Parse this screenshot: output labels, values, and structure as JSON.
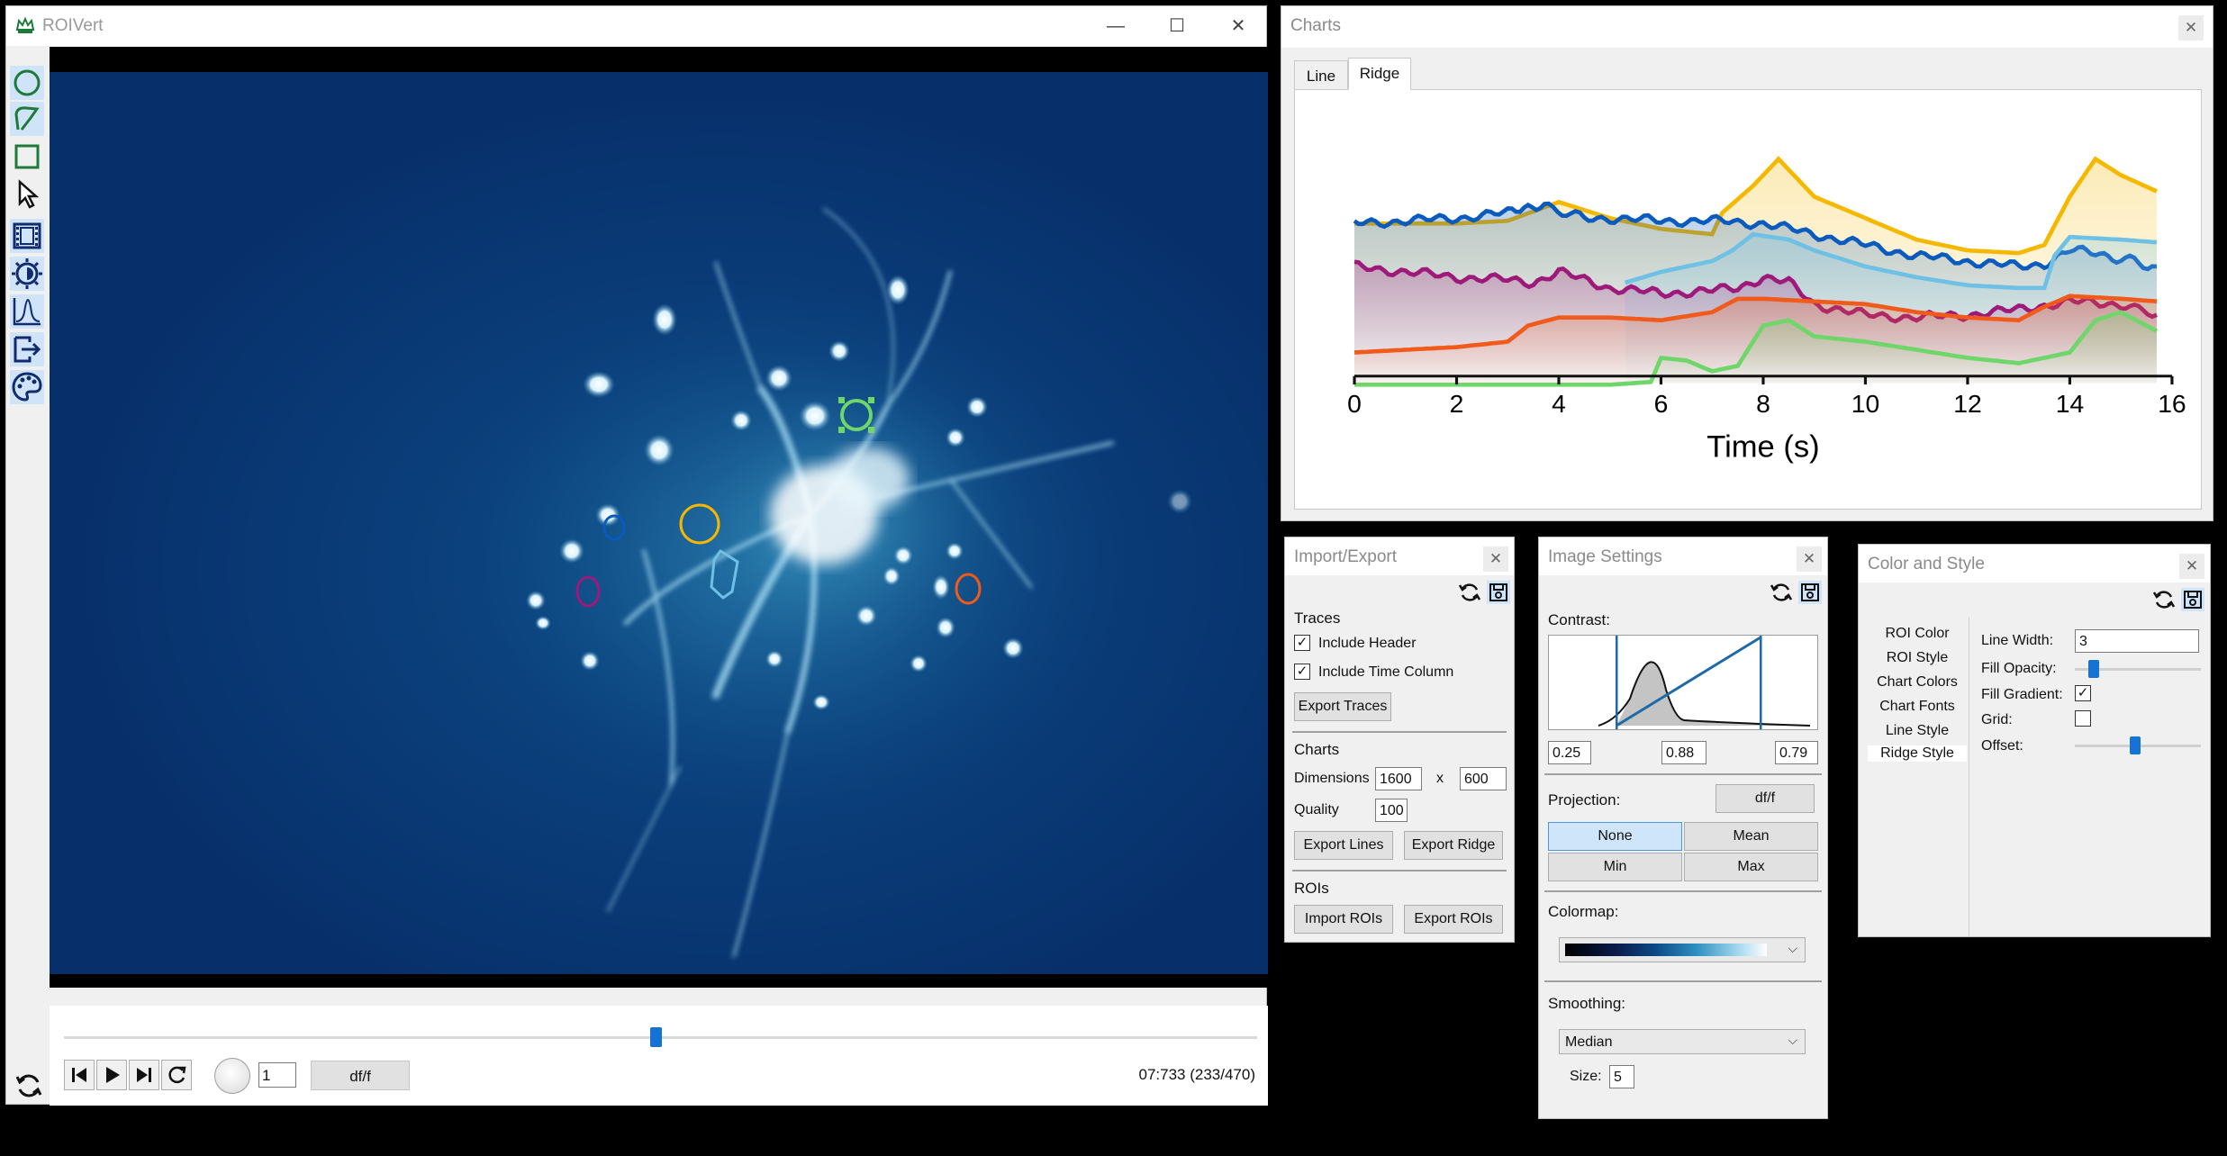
{
  "main_window": {
    "title": "ROIVert",
    "minimize": "—",
    "maximize": "☐",
    "close": "✕",
    "frame_number": "1",
    "mode_button": "df/f",
    "frame_info": "07:733 (233/470)",
    "slider_fraction": 0.496
  },
  "toolbar": {
    "tools": [
      "ellipse-roi-icon",
      "polygon-roi-icon",
      "rectangle-roi-icon",
      "select-pointer-icon",
      "video-icon",
      "image-settings-icon",
      "charts-icon",
      "import-export-icon",
      "color-style-icon"
    ]
  },
  "charts_window": {
    "title": "Charts",
    "tabs": [
      "Line",
      "Ridge"
    ],
    "active_tab": "Ridge"
  },
  "chart_data": {
    "type": "area",
    "xlabel": "Time (s)",
    "ylabel": "",
    "xlim": [
      0,
      16
    ],
    "xticks": [
      "0",
      "2",
      "4",
      "6",
      "8",
      "10",
      "12",
      "14",
      "16"
    ],
    "fill_gradient": true,
    "series": [
      {
        "color": "#f5b800",
        "x": [
          0,
          1,
          2,
          3,
          4,
          5,
          6,
          7,
          7.2,
          7.8,
          8.3,
          9,
          10,
          11,
          12,
          13,
          13.5,
          14,
          14.5,
          15,
          15.7
        ],
        "values": [
          9.1,
          9.1,
          9.1,
          9.15,
          9.5,
          9.2,
          9.0,
          8.9,
          9.3,
          9.8,
          10.3,
          9.6,
          9.2,
          8.8,
          8.6,
          8.55,
          8.7,
          9.6,
          10.3,
          10.0,
          9.7
        ]
      },
      {
        "color": "#0b5bbf",
        "x": [
          0,
          1,
          2,
          3,
          3.8,
          4.5,
          5,
          6,
          7,
          8,
          8.5,
          9,
          10,
          11,
          12,
          13,
          13.5,
          14,
          14.5,
          15,
          15.7
        ],
        "values": [
          9.1,
          9.15,
          9.2,
          9.3,
          9.4,
          9.2,
          9.2,
          9.15,
          9.15,
          9.1,
          9.0,
          8.9,
          8.7,
          8.5,
          8.4,
          8.3,
          8.35,
          8.6,
          8.55,
          8.45,
          8.3
        ]
      },
      {
        "color": "#6ec1e4",
        "x": [
          5.3,
          6,
          7,
          7.4,
          7.8,
          8.5,
          9,
          10,
          11,
          12,
          13,
          13.5,
          13.7,
          14,
          15,
          15.7
        ],
        "values": [
          8.0,
          8.2,
          8.4,
          8.6,
          8.9,
          8.8,
          8.6,
          8.3,
          8.1,
          7.95,
          7.9,
          7.9,
          8.5,
          8.85,
          8.8,
          8.75
        ],
        "start_fill": true
      },
      {
        "color": "#9e1a7a",
        "x": [
          0,
          1,
          2,
          3,
          3.5,
          4,
          5,
          6,
          7,
          7.5,
          8,
          8.5,
          9,
          10,
          11,
          12,
          13,
          14,
          15,
          15.7
        ],
        "values": [
          8.3,
          8.2,
          8.1,
          8.05,
          8.0,
          8.2,
          7.9,
          7.8,
          7.85,
          7.9,
          8.1,
          8.0,
          7.6,
          7.4,
          7.35,
          7.4,
          7.5,
          7.65,
          7.6,
          7.4
        ]
      },
      {
        "color": "#f05a1a",
        "x": [
          0,
          1,
          2,
          3,
          3.4,
          4,
          5,
          6,
          7,
          7.5,
          8,
          9,
          10,
          11,
          12,
          13,
          13.5,
          14,
          15,
          15.7
        ],
        "values": [
          6.7,
          6.75,
          6.8,
          6.9,
          7.2,
          7.35,
          7.35,
          7.3,
          7.45,
          7.7,
          7.7,
          7.65,
          7.6,
          7.45,
          7.35,
          7.3,
          7.55,
          7.75,
          7.7,
          7.65
        ]
      },
      {
        "color": "#6fd66a",
        "x": [
          0,
          1,
          2,
          3,
          4,
          5,
          5.8,
          6,
          6.5,
          7,
          7.5,
          8,
          8.5,
          9,
          10,
          11,
          12,
          13,
          14,
          14.5,
          15,
          15.7
        ],
        "values": [
          6.1,
          6.1,
          6.1,
          6.1,
          6.1,
          6.1,
          6.15,
          6.6,
          6.55,
          6.35,
          6.45,
          7.2,
          7.3,
          7.0,
          6.9,
          6.75,
          6.6,
          6.5,
          6.7,
          7.3,
          7.45,
          7.1
        ]
      }
    ]
  },
  "import_export": {
    "title": "Import/Export",
    "traces_label": "Traces",
    "include_header": "Include Header",
    "include_time": "Include Time Column",
    "export_traces": "Export Traces",
    "charts_label": "Charts",
    "dimensions_label": "Dimensions",
    "width": "1600",
    "x_sep": "x",
    "height": "600",
    "quality_label": "Quality",
    "quality": "100",
    "export_lines": "Export Lines",
    "export_ridge": "Export Ridge",
    "rois_label": "ROIs",
    "import_rois": "Import ROIs",
    "export_rois": "Export ROIs"
  },
  "image_settings": {
    "title": "Image Settings",
    "contrast_label": "Contrast:",
    "contrast_min": "0.25",
    "contrast_gamma": "0.88",
    "contrast_max": "0.79",
    "projection_label": "Projection:",
    "projection_mode": "df/f",
    "proj_none": "None",
    "proj_mean": "Mean",
    "proj_min": "Min",
    "proj_max": "Max",
    "colormap_label": "Colormap:",
    "smoothing_label": "Smoothing:",
    "smoothing_value": "Median",
    "size_label": "Size:",
    "size_value": "5"
  },
  "color_style": {
    "title": "Color and Style",
    "menu": [
      "ROI Color",
      "ROI Style",
      "Chart Colors",
      "Chart Fonts",
      "Line Style",
      "Ridge Style"
    ],
    "line_width_label": "Line Width:",
    "line_width": "3",
    "fill_opacity_label": "Fill Opacity:",
    "fill_opacity_fraction": 0.12,
    "fill_gradient_label": "Fill Gradient:",
    "grid_label": "Grid:",
    "offset_label": "Offset:",
    "offset_fraction": 0.48
  }
}
